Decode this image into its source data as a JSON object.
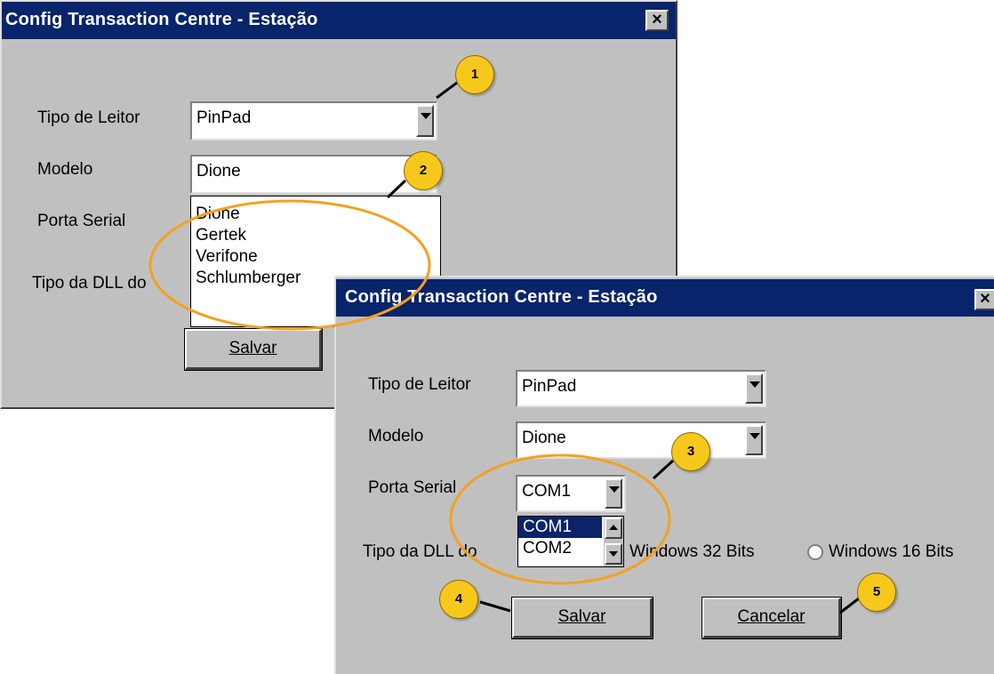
{
  "window_back": {
    "title": "Config Transaction Centre - Estação",
    "close_label": "×",
    "label_tipo_leitor": "Tipo de Leitor",
    "tipo_leitor_value": "PinPad",
    "label_modelo": "Modelo",
    "modelo_value": "Dione",
    "label_porta": "Porta Serial",
    "label_dll": "Tipo da DLL  do",
    "modelo_options": [
      "Dione",
      "Gertek",
      "Verifone",
      "Schlumberger"
    ],
    "salvar_label": "Salvar"
  },
  "window_front": {
    "title": "Config Transaction Centre - Estação",
    "close_label": "×",
    "label_tipo_leitor": "Tipo de Leitor",
    "tipo_leitor_value": "PinPad",
    "label_modelo": "Modelo",
    "modelo_value": "Dione",
    "label_porta": "Porta Serial",
    "porta_value": "COM1",
    "porta_options": [
      "COM1",
      "COM2"
    ],
    "label_dll": "Tipo da DLL  do",
    "radio_32": "Windows 32 Bits",
    "radio_16": "Windows 16 Bits",
    "salvar_label": "Salvar",
    "cancelar_label": "Cancelar"
  },
  "callouts": [
    "1",
    "2",
    "3",
    "4",
    "5"
  ],
  "colors": {
    "titlebar": "#08246b",
    "dialog_bg": "#c0c0c0",
    "callout_fill": "#f7c81c",
    "highlight_ellipse": "#f4a020",
    "selection": "#0a246a"
  }
}
